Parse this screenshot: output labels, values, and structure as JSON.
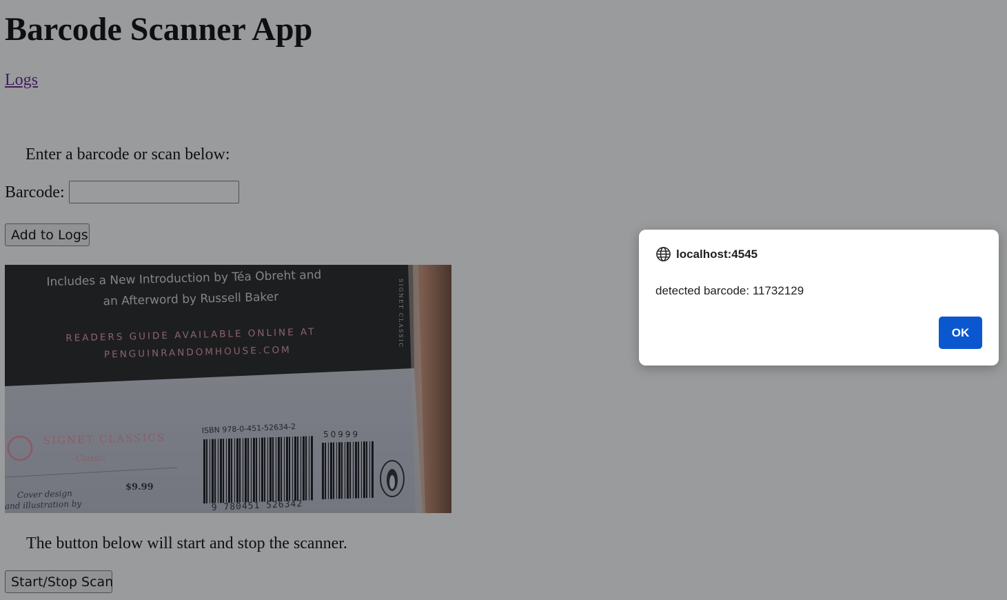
{
  "page": {
    "title": "Barcode Scanner App",
    "logs_link": "Logs",
    "intro_text": "Enter a barcode or scan below:",
    "barcode_label": "Barcode:",
    "barcode_value": "",
    "add_button": "Add to Logs",
    "scanner_note": "The button below will start and stop the scanner.",
    "scan_button": "Start/Stop Scan"
  },
  "camera": {
    "line1": "Includes a New Introduction by Téa Obreht and",
    "line2": "an Afterword by Russell Baker",
    "line3": "READERS GUIDE AVAILABLE ONLINE AT",
    "line4": "PENGUINRANDOMHOUSE.COM",
    "isbn": "ISBN 978-0-451-52634-2",
    "price_code": "50999",
    "barcode_digits": "9 780451 526342",
    "publisher_logo": "SIGNET CLASSICS",
    "publisher_sub": "Classic",
    "price": "$9.99",
    "credit1": "Cover design",
    "credit2": "and illustration by",
    "spine": "SIGNET CLASSIC"
  },
  "dialog": {
    "origin": "localhost:4545",
    "message": "detected barcode: 11732129",
    "ok_label": "OK"
  },
  "colors": {
    "link": "#551a8b",
    "overlay": "rgba(32,33,36,0.45)",
    "dialog_button": "#0b57d0"
  }
}
